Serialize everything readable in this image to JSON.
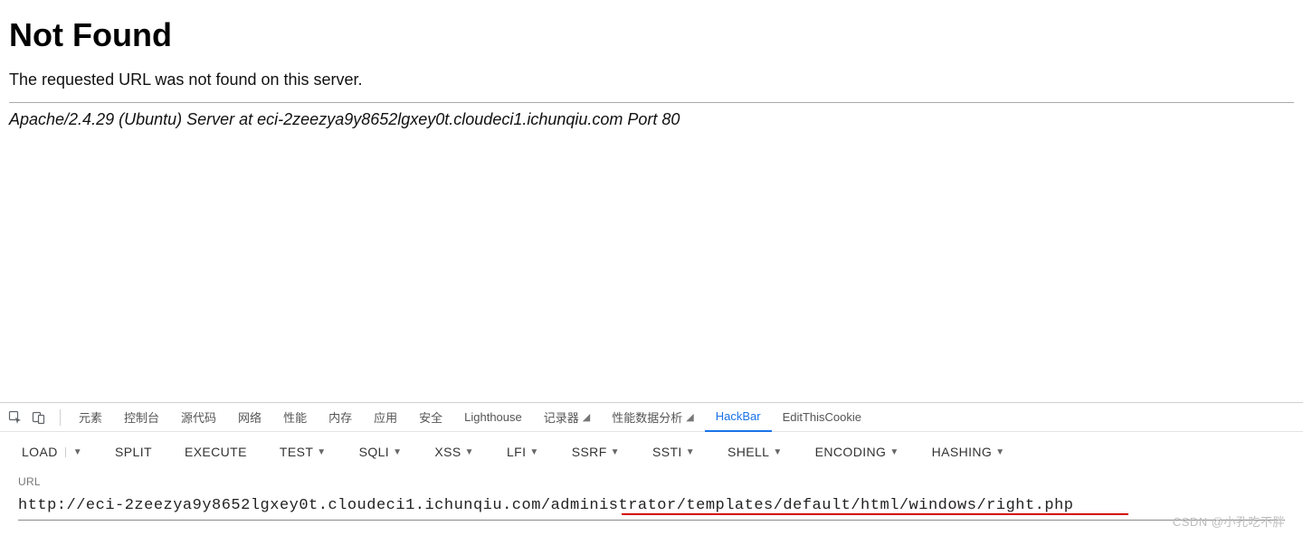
{
  "error_page": {
    "title": "Not Found",
    "message": "The requested URL was not found on this server.",
    "signature": "Apache/2.4.29 (Ubuntu) Server at eci-2zeezya9y8652lgxey0t.cloudeci1.ichunqiu.com Port 80"
  },
  "devtools": {
    "tabs": [
      "元素",
      "控制台",
      "源代码",
      "网络",
      "性能",
      "内存",
      "应用",
      "安全",
      "Lighthouse",
      "记录器",
      "性能数据分析",
      "HackBar",
      "EditThisCookie"
    ],
    "active_tab": "HackBar"
  },
  "hackbar": {
    "buttons": {
      "load": "LOAD",
      "split": "SPLIT",
      "execute": "EXECUTE",
      "test": "TEST",
      "sqli": "SQLI",
      "xss": "XSS",
      "lfi": "LFI",
      "ssrf": "SSRF",
      "ssti": "SSTI",
      "shell": "SHELL",
      "encoding": "ENCODING",
      "hashing": "HASHING"
    },
    "url_label": "URL",
    "url_value": "http://eci-2zeezya9y8652lgxey0t.cloudeci1.ichunqiu.com/administrator/templates/default/html/windows/right.php"
  },
  "watermark": "CSDN @小孔吃不胖"
}
